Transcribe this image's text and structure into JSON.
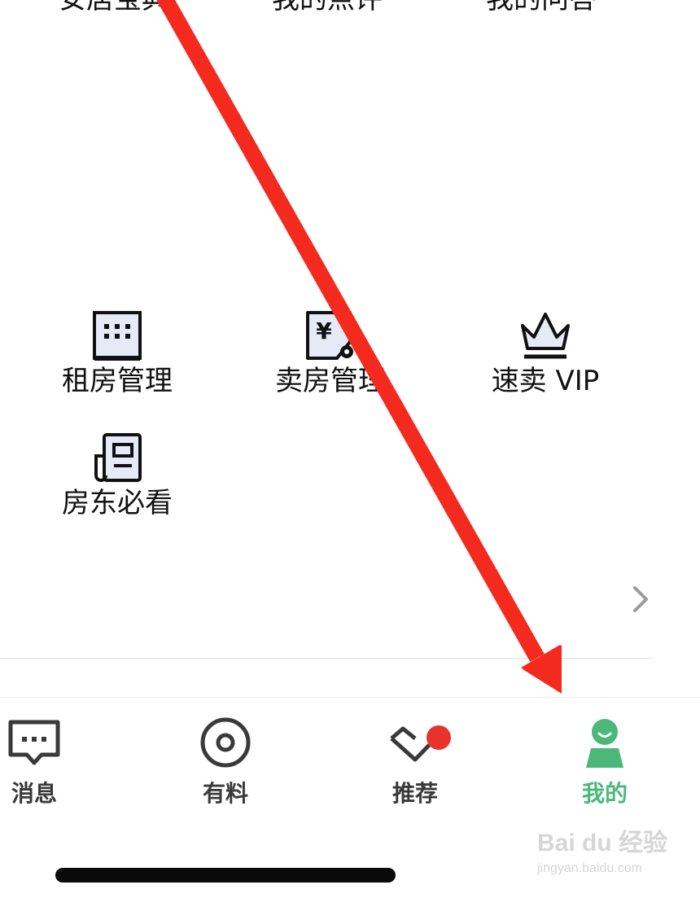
{
  "top_row": {
    "items": [
      {
        "label": "安居宝典"
      },
      {
        "label": "我的点评"
      },
      {
        "label": "我的问答"
      }
    ]
  },
  "grid": {
    "items": [
      {
        "label": "租房管理",
        "icon": "building-icon"
      },
      {
        "label": "卖房管理",
        "icon": "price-tag-icon"
      },
      {
        "label": "速卖 VIP",
        "icon": "crown-icon"
      },
      {
        "label": "房东必看",
        "icon": "newspaper-icon"
      }
    ]
  },
  "tabbar": {
    "tabs": [
      {
        "label": "消息",
        "icon": "message-icon",
        "active": false
      },
      {
        "label": "有料",
        "icon": "target-icon",
        "active": false
      },
      {
        "label": "推荐",
        "icon": "heart-check-icon",
        "active": false,
        "badge": true
      },
      {
        "label": "我的",
        "icon": "profile-icon",
        "active": true
      }
    ]
  },
  "colors": {
    "active_tab": "#4bb87a",
    "badge": "#e8332b",
    "arrow": "#f42a1f",
    "icon_fill": "#e6eaf6"
  },
  "watermark": {
    "main": "Bai du 经验",
    "sub": "jingyan.baidu.com"
  }
}
